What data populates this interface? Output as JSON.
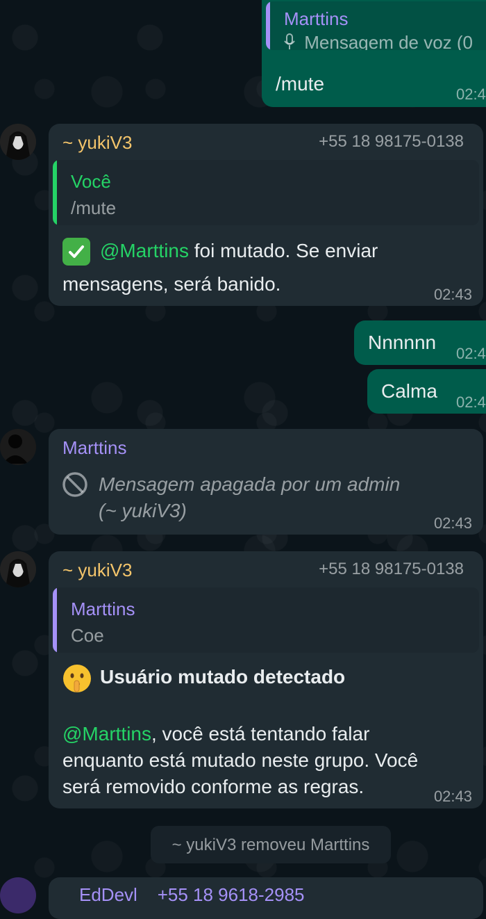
{
  "messages": {
    "m1": {
      "quote_sender": "Marttins",
      "quote_text": "Mensagem de voz (0",
      "text": "/mute",
      "time": "02:4"
    },
    "m2": {
      "sender": "~ yukiV3",
      "phone": "+55 18 98175-0138",
      "quote_sender": "Você",
      "quote_text": "/mute",
      "mention": "@Marttins",
      "text_after": " foi mutado. Se enviar",
      "text_line2": "mensagens, será banido.",
      "time": "02:43"
    },
    "m3": {
      "text": "Nnnnnn",
      "time": "02:4"
    },
    "m4": {
      "text": "Calma",
      "time": "02:4"
    },
    "m5": {
      "sender": "Marttins",
      "deleted_line1": "Mensagem apagada por um admin",
      "deleted_line2": "(~ yukiV3)",
      "time": "02:43"
    },
    "m6": {
      "sender": "~ yukiV3",
      "phone": "+55 18 98175-0138",
      "quote_sender": "Marttins",
      "quote_text": "Coe",
      "heading": "Usuário mutado detectado",
      "mention": "@Marttins",
      "text_line1_after": ", você está tentando falar",
      "text_line2": "enquanto está mutado neste grupo. Você",
      "text_line3": "será removido conforme as regras.",
      "time": "02:43"
    }
  },
  "system_note": "~ yukiV3 removeu Marttins",
  "partial_bottom_text": "EdDevl    +55 18 9618-2985",
  "colors": {
    "background": "#0b141a",
    "outgoing_bubble": "#005c4b",
    "incoming_bubble": "#202c33",
    "sender_yellow": "#f4c56b",
    "sender_purple": "#a591f7",
    "quote_green": "#25d366",
    "mention_green": "#25d366"
  },
  "icons": {
    "mic": "microphone-icon",
    "check": "check-mark-emoji",
    "blocked": "prohibited-icon",
    "shush": "shushing-face-emoji"
  }
}
